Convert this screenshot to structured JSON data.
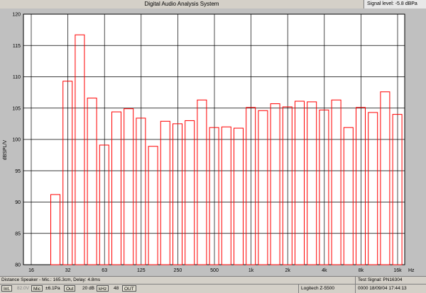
{
  "window": {
    "title": "Digital Audio Analysis System",
    "signal_level": "Signal level: -5.8 dBPa"
  },
  "chart_data": {
    "type": "bar",
    "ylabel": "dBSPL/V",
    "xlabel": "Hz",
    "ylim": [
      80,
      120
    ],
    "yticks": [
      "120",
      "115",
      "110",
      "105",
      "100",
      "95",
      "90",
      "85",
      "80"
    ],
    "xticks": [
      "16",
      "32",
      "63",
      "125",
      "250",
      "500",
      "1k",
      "2k",
      "4k",
      "8k",
      "16k"
    ],
    "bar_color": "#ff0000",
    "values": [
      91.2,
      109.3,
      116.7,
      106.6,
      99.1,
      104.4,
      104.9,
      103.4,
      98.9,
      102.9,
      102.5,
      103.0,
      106.3,
      101.9,
      102.0,
      101.8,
      105.1,
      104.6,
      105.7,
      105.2,
      106.1,
      106.0,
      104.7,
      106.3,
      101.9,
      105.1,
      104.3,
      107.6,
      104.0
    ]
  },
  "status": {
    "distance": "Distance Speaker - Mic.: 165.3cm, Delay: 4.8ms",
    "test_signal": "Test Signal: PN16304",
    "int_btn": "Int.",
    "level": "82.0V",
    "mic_btn": "Mic",
    "pa": "±6.1Pa",
    "out_btn": "Out",
    "gain": "20 dB",
    "khz_btn": "kHz",
    "val48": "48",
    "out2_btn": "OUT",
    "device": "Logitech Z-5500",
    "date": "0000  18/09/04  17:44:13"
  }
}
